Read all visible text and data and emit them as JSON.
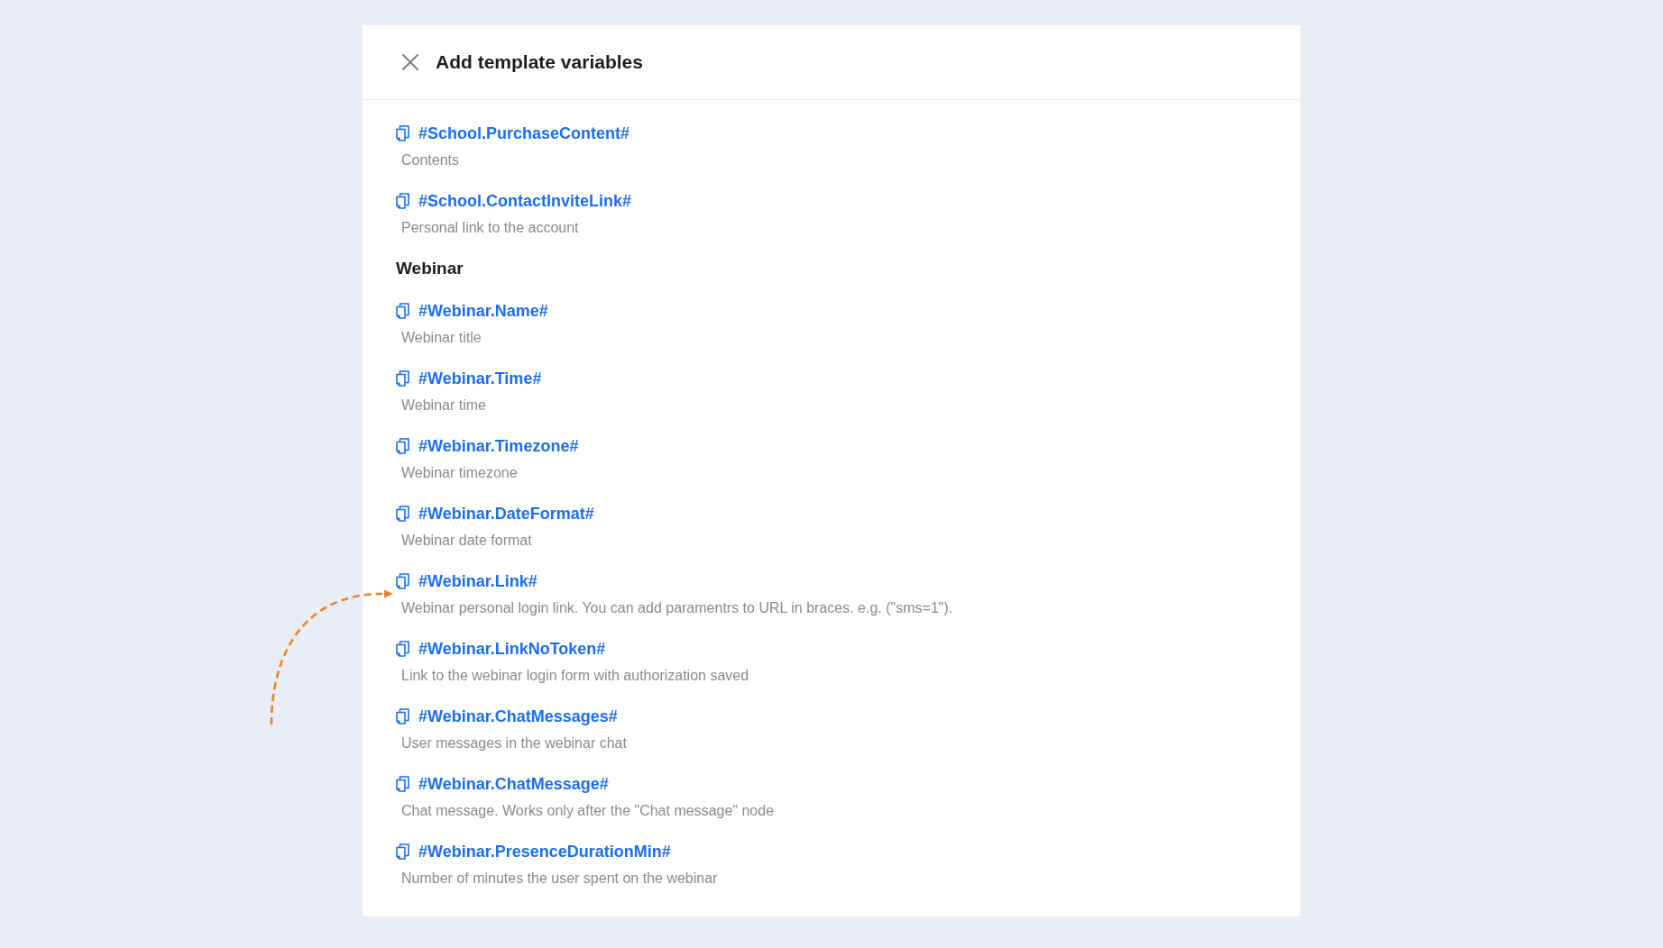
{
  "dialog": {
    "title": "Add template variables",
    "sections": [
      {
        "variables": [
          {
            "name": "#School.PurchaseContent#",
            "description": "Contents"
          },
          {
            "name": "#School.ContactInviteLink#",
            "description": "Personal link to the account"
          }
        ]
      },
      {
        "heading": "Webinar",
        "variables": [
          {
            "name": "#Webinar.Name#",
            "description": "Webinar title"
          },
          {
            "name": "#Webinar.Time#",
            "description": "Webinar time"
          },
          {
            "name": "#Webinar.Timezone#",
            "description": "Webinar timezone"
          },
          {
            "name": "#Webinar.DateFormat#",
            "description": "Webinar date format"
          },
          {
            "name": "#Webinar.Link#",
            "description": "Webinar personal login link. You can add paramentrs to URL in braces. e.g. (\"sms=1\")."
          },
          {
            "name": "#Webinar.LinkNoToken#",
            "description": "Link to the webinar login form with authorization saved"
          },
          {
            "name": "#Webinar.ChatMessages#",
            "description": "User messages in the webinar chat"
          },
          {
            "name": "#Webinar.ChatMessage#",
            "description": "Chat message. Works only after the \"Chat message\" node"
          },
          {
            "name": "#Webinar.PresenceDurationMin#",
            "description": "Number of minutes the user spent on the webinar"
          }
        ]
      }
    ]
  }
}
